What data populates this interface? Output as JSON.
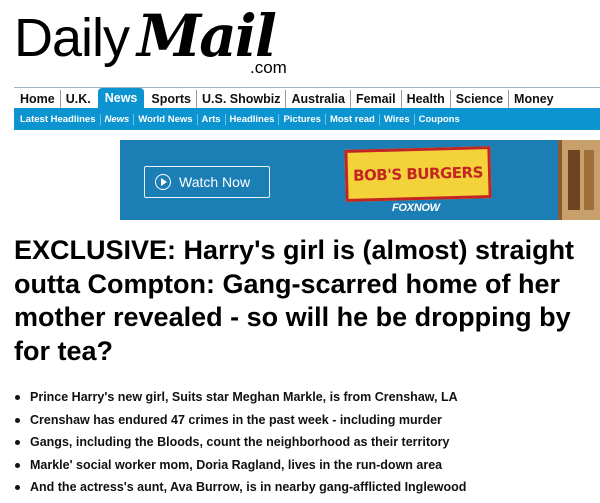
{
  "masthead": {
    "logo_daily": "Daily",
    "logo_mail": "Mail",
    "logo_domain": ".com"
  },
  "primary_nav": {
    "items": [
      "Home",
      "U.K.",
      "News",
      "Sports",
      "U.S. Showbiz",
      "Australia",
      "Femail",
      "Health",
      "Science",
      "Money"
    ],
    "active": "News"
  },
  "secondary_nav": {
    "items": [
      "Latest Headlines",
      "News",
      "World News",
      "Arts",
      "Headlines",
      "Pictures",
      "Most read",
      "Wires",
      "Coupons"
    ]
  },
  "ad": {
    "button_label": "Watch Now",
    "show_title": "BOB'S BURGERS",
    "network": "FOXNOW"
  },
  "article": {
    "headline": "EXCLUSIVE: Harry's girl is (almost) straight outta Compton: Gang-scarred home of her mother revealed - so will he be dropping by for tea?",
    "bullets": [
      "Prince Harry's new girl, Suits star Meghan Markle, is from Crenshaw, LA",
      "Crenshaw has endured 47 crimes in the past week - including murder",
      "Gangs, including the Bloods, count the neighborhood as their territory",
      "Markle' social worker mom, Doria Ragland, lives in the run-down area",
      "And the actress's aunt, Ava Burrow, is in nearby gang-afflicted Inglewood"
    ]
  },
  "colors": {
    "accent": "#0b94cf",
    "ad_background": "#1b7fb6",
    "ad_logo_fill": "#f4d23a",
    "ad_logo_red": "#c22524"
  }
}
